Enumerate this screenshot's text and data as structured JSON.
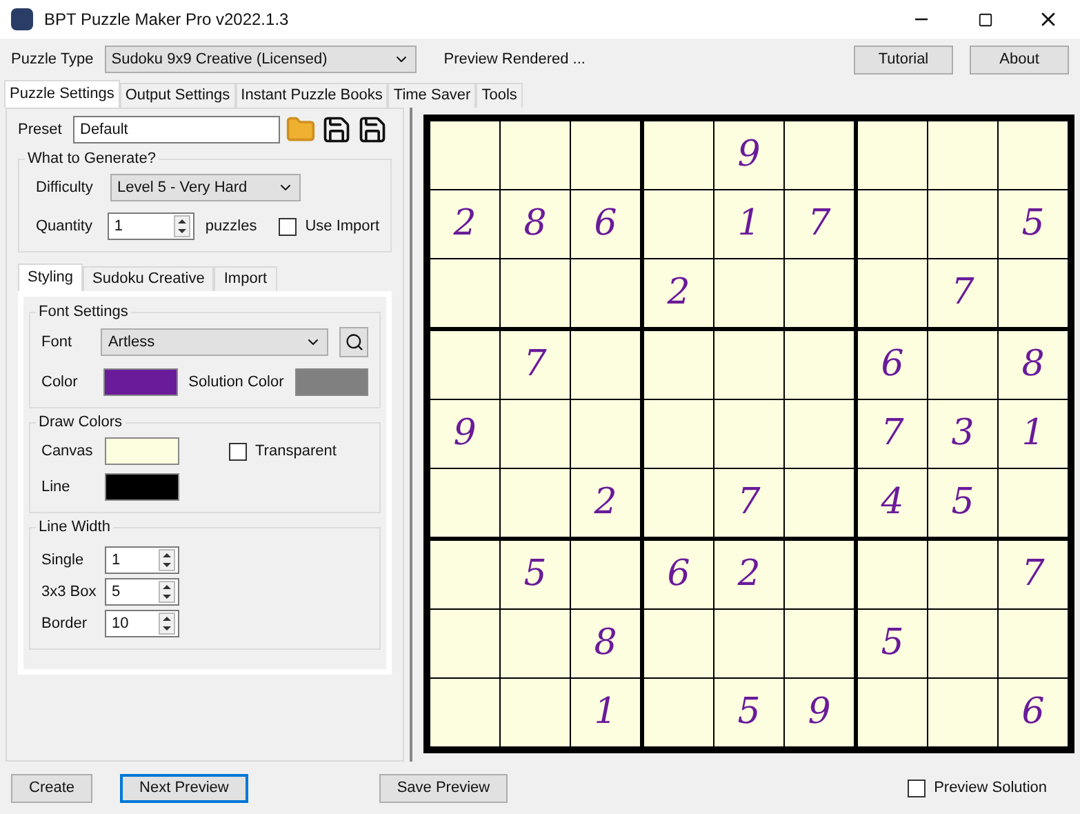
{
  "window": {
    "title": "BPT Puzzle Maker Pro v2022.1.3"
  },
  "toolbar": {
    "puzzle_type_label": "Puzzle Type",
    "puzzle_type": "Sudoku 9x9 Creative (Licensed)",
    "status": "Preview Rendered ...",
    "buttons": [
      "Tutorial",
      "About"
    ]
  },
  "tabs": [
    {
      "label": "Puzzle Settings",
      "selected": true
    },
    {
      "label": "Output Settings",
      "selected": false
    },
    {
      "label": "Instant Puzzle Books",
      "selected": false
    },
    {
      "label": "Time Saver",
      "selected": false
    },
    {
      "label": "Tools",
      "selected": false
    }
  ],
  "preset": {
    "label": "Preset",
    "value": "Default"
  },
  "generate": {
    "title": "What to Generate?",
    "difficulty_label": "Difficulty",
    "difficulty": "Level 5 - Very Hard",
    "quantity_label": "Quantity",
    "quantity": "1",
    "quantity_unit": "puzzles",
    "use_import": {
      "label": "Use Import",
      "checked": false
    }
  },
  "sub_tabs": [
    {
      "label": "Styling",
      "selected": true
    },
    {
      "label": "Sudoku Creative",
      "selected": false
    },
    {
      "label": "Import",
      "selected": false
    }
  ],
  "font_settings": {
    "title": "Font Settings",
    "font_label": "Font",
    "font": "Artless",
    "colors": [
      {
        "label": "Color",
        "color": "#6a1b9a"
      },
      {
        "label": "Solution Color",
        "color": "#808080"
      }
    ]
  },
  "draw_colors": {
    "title": "Draw Colors",
    "colors": [
      {
        "label": "Canvas",
        "color": "#fdfde0"
      },
      {
        "label": "Line",
        "color": "#000000"
      }
    ],
    "transparent": {
      "label": "Transparent",
      "checked": false
    }
  },
  "line_width": {
    "title": "Line Width",
    "fields": [
      {
        "label": "Single",
        "value": "1"
      },
      {
        "label": "3x3 Box",
        "value": "5"
      },
      {
        "label": "Border",
        "value": "10"
      }
    ]
  },
  "grid": [
    [
      {
        "kind": "empty"
      },
      {
        "kind": "empty"
      },
      {
        "kind": "empty"
      },
      {
        "kind": "empty"
      },
      {
        "kind": "given",
        "value": "9"
      },
      {
        "kind": "empty"
      },
      {
        "kind": "empty"
      },
      {
        "kind": "empty"
      },
      {
        "kind": "empty"
      }
    ],
    [
      {
        "kind": "given",
        "value": "2"
      },
      {
        "kind": "given",
        "value": "8"
      },
      {
        "kind": "given",
        "value": "6"
      },
      {
        "kind": "empty"
      },
      {
        "kind": "given",
        "value": "1"
      },
      {
        "kind": "given",
        "value": "7"
      },
      {
        "kind": "empty"
      },
      {
        "kind": "empty"
      },
      {
        "kind": "given",
        "value": "5"
      }
    ],
    [
      {
        "kind": "empty"
      },
      {
        "kind": "empty"
      },
      {
        "kind": "empty"
      },
      {
        "kind": "given",
        "value": "2"
      },
      {
        "kind": "empty"
      },
      {
        "kind": "empty"
      },
      {
        "kind": "empty"
      },
      {
        "kind": "given",
        "value": "7"
      },
      {
        "kind": "empty"
      }
    ],
    [
      {
        "kind": "empty"
      },
      {
        "kind": "given",
        "value": "7"
      },
      {
        "kind": "empty"
      },
      {
        "kind": "empty"
      },
      {
        "kind": "empty"
      },
      {
        "kind": "empty"
      },
      {
        "kind": "given",
        "value": "6"
      },
      {
        "kind": "empty"
      },
      {
        "kind": "given",
        "value": "8"
      }
    ],
    [
      {
        "kind": "given",
        "value": "9"
      },
      {
        "kind": "empty"
      },
      {
        "kind": "empty"
      },
      {
        "kind": "empty"
      },
      {
        "kind": "empty"
      },
      {
        "kind": "empty"
      },
      {
        "kind": "given",
        "value": "7"
      },
      {
        "kind": "given",
        "value": "3"
      },
      {
        "kind": "given",
        "value": "1"
      }
    ],
    [
      {
        "kind": "empty"
      },
      {
        "kind": "empty"
      },
      {
        "kind": "given",
        "value": "2"
      },
      {
        "kind": "empty"
      },
      {
        "kind": "given",
        "value": "7"
      },
      {
        "kind": "empty"
      },
      {
        "kind": "given",
        "value": "4"
      },
      {
        "kind": "given",
        "value": "5"
      },
      {
        "kind": "empty"
      }
    ],
    [
      {
        "kind": "empty"
      },
      {
        "kind": "given",
        "value": "5"
      },
      {
        "kind": "empty"
      },
      {
        "kind": "given",
        "value": "6"
      },
      {
        "kind": "given",
        "value": "2"
      },
      {
        "kind": "empty"
      },
      {
        "kind": "empty"
      },
      {
        "kind": "empty"
      },
      {
        "kind": "given",
        "value": "7"
      }
    ],
    [
      {
        "kind": "empty"
      },
      {
        "kind": "empty"
      },
      {
        "kind": "given",
        "value": "8"
      },
      {
        "kind": "empty"
      },
      {
        "kind": "empty"
      },
      {
        "kind": "empty"
      },
      {
        "kind": "given",
        "value": "5"
      },
      {
        "kind": "empty"
      },
      {
        "kind": "empty"
      }
    ],
    [
      {
        "kind": "empty"
      },
      {
        "kind": "empty"
      },
      {
        "kind": "given",
        "value": "1"
      },
      {
        "kind": "empty"
      },
      {
        "kind": "given",
        "value": "5"
      },
      {
        "kind": "given",
        "value": "9"
      },
      {
        "kind": "empty"
      },
      {
        "kind": "empty"
      },
      {
        "kind": "given",
        "value": "6"
      }
    ]
  ],
  "bottom": {
    "buttons": [
      {
        "label": "Create",
        "focused": false
      },
      {
        "label": "Next Preview",
        "focused": true
      },
      {
        "label": "Save Preview",
        "focused": false
      }
    ],
    "preview_solution": {
      "label": "Preview Solution",
      "checked": false
    }
  }
}
